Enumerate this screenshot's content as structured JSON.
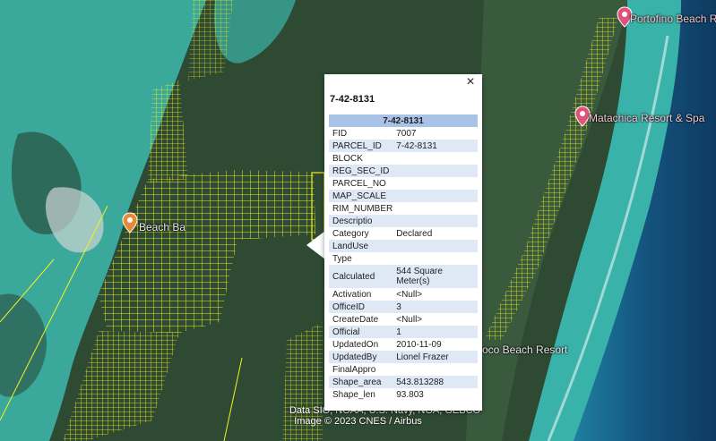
{
  "map": {
    "colors": {
      "lagoon": "#3aa89a",
      "deep_sea": "#0e3f66",
      "reef_sea": "#1f7fa0",
      "land": "#2f4a33",
      "parcel_lines": "#f4f21a"
    },
    "pins": [
      {
        "label": "Portofino Beach Res",
        "icon": "map-pin-icon",
        "color": "#e0527a"
      },
      {
        "label": "Matachica Resort & Spa",
        "icon": "map-pin-icon",
        "color": "#e0527a"
      },
      {
        "label": "Beach Ba",
        "icon": "map-pin-icon",
        "color": "#e8893a"
      },
      {
        "label": "oco Beach Resort",
        "icon": "map-pin-icon",
        "color": "#e0527a"
      }
    ],
    "attribution_line1": "Data SIO, NOAA, U.S. Navy, NGA, GEBCO",
    "attribution_line2": "Image © 2023 CNES / Airbus"
  },
  "popup": {
    "title": "7-42-8131",
    "close_label": "×",
    "table_header": "7-42-8131",
    "rows": [
      {
        "key": "FID",
        "value": "7007"
      },
      {
        "key": "PARCEL_ID",
        "value": "7-42-8131"
      },
      {
        "key": "BLOCK",
        "value": ""
      },
      {
        "key": "REG_SEC_ID",
        "value": ""
      },
      {
        "key": "PARCEL_NO",
        "value": ""
      },
      {
        "key": "MAP_SCALE",
        "value": ""
      },
      {
        "key": "RIM_NUMBER",
        "value": ""
      },
      {
        "key": "Descriptio",
        "value": ""
      },
      {
        "key": "Category",
        "value": "Declared"
      },
      {
        "key": "LandUse",
        "value": ""
      },
      {
        "key": "Type",
        "value": ""
      },
      {
        "key": "Calculated",
        "value": "544 Square Meter(s)"
      },
      {
        "key": "Activation",
        "value": "<Null>"
      },
      {
        "key": "OfficeID",
        "value": "3"
      },
      {
        "key": "CreateDate",
        "value": "<Null>"
      },
      {
        "key": "Official",
        "value": "1"
      },
      {
        "key": "UpdatedOn",
        "value": "2010-11-09"
      },
      {
        "key": "UpdatedBy",
        "value": "Lionel Frazer"
      },
      {
        "key": "FinalAppro",
        "value": ""
      },
      {
        "key": "Shape_area",
        "value": "543.813288"
      },
      {
        "key": "Shape_len",
        "value": "93.803"
      }
    ]
  }
}
